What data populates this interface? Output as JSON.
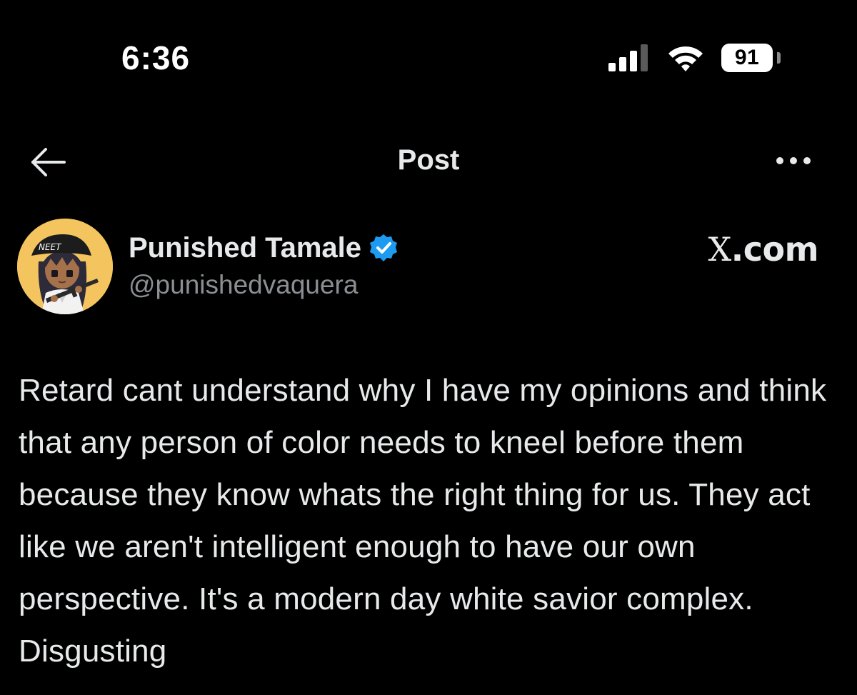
{
  "status_bar": {
    "time": "6:36",
    "battery": "91",
    "icons": [
      "cellular-signal-icon",
      "wifi-icon",
      "battery-icon"
    ]
  },
  "nav": {
    "title": "Post",
    "back_icon": "arrow-left-icon",
    "more_icon": "more-horizontal-icon"
  },
  "author": {
    "display_name": "Punished Tamale",
    "handle": "@punishedvaquera",
    "verified": true,
    "avatar_text": "NEET",
    "avatar_icon": "anime-character-avatar-icon"
  },
  "watermark": {
    "x": "X",
    "dotcom": ".com"
  },
  "post": {
    "text": "Retard cant understand why I have my opinions and think that any person of color needs to kneel before them because they know whats the right thing for us. They act like we aren't intelligent enough to have our own perspective. It's a modern day white savior complex. Disgusting"
  },
  "colors": {
    "background": "#000000",
    "text_primary": "#e7e9ea",
    "text_secondary": "#8b8f94",
    "verified_blue": "#1d9bf0",
    "avatar_bg": "#f4c55e"
  }
}
